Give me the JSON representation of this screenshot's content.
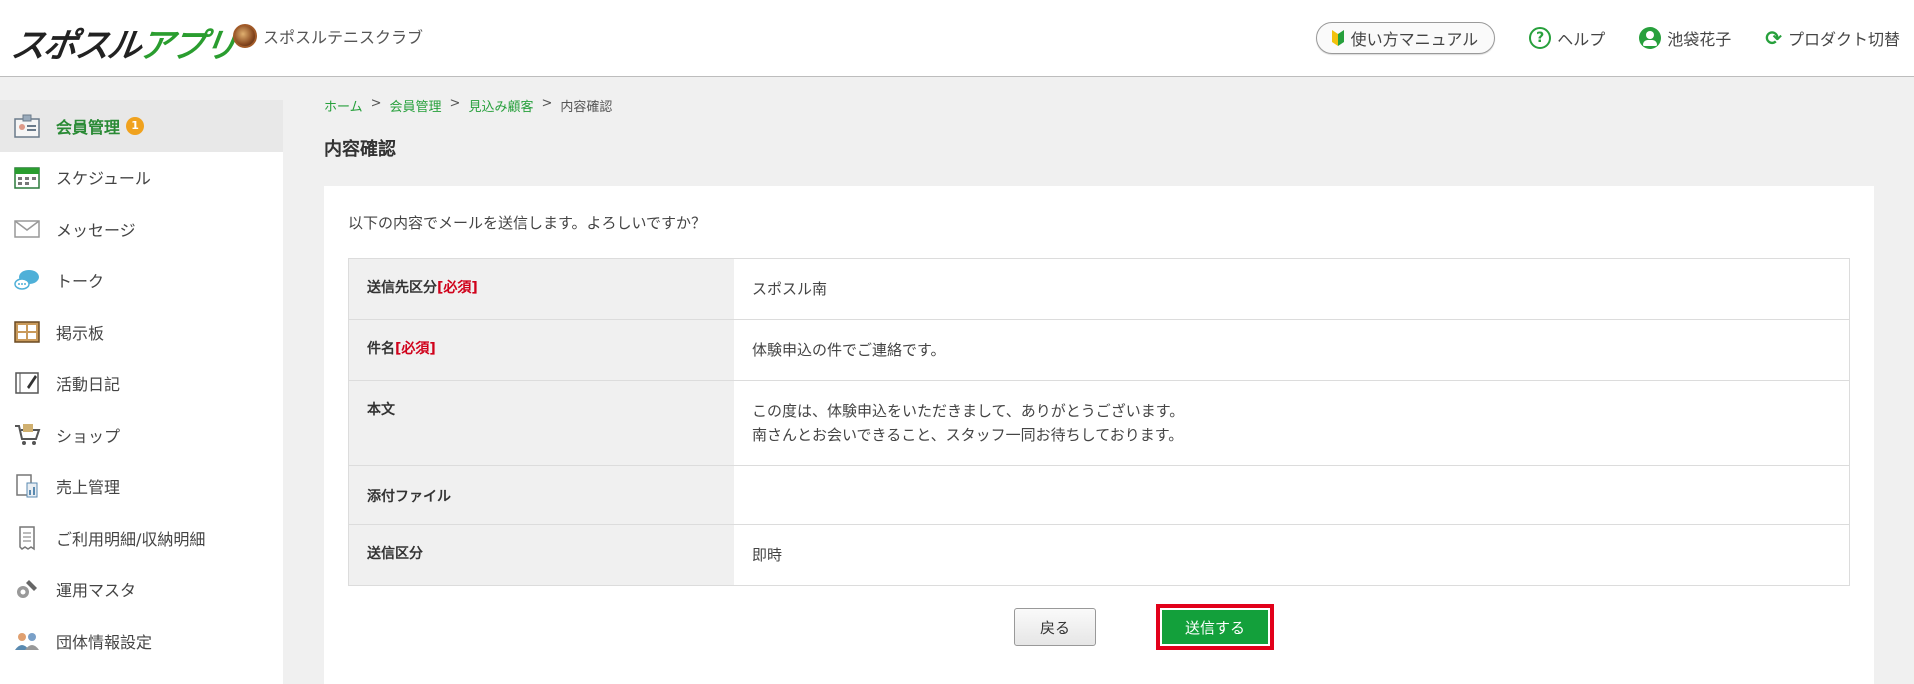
{
  "header": {
    "logo_part1": "スポスル",
    "logo_part2": "アプリ",
    "club_name": "スポスルテニスクラブ",
    "manual_label": "使い方マニュアル",
    "help_label": "ヘルプ",
    "user_name": "池袋花子",
    "switch_label": "プロダクト切替"
  },
  "sidebar": {
    "items": [
      {
        "label": "会員管理",
        "badge": "1",
        "icon": "member-icon"
      },
      {
        "label": "スケジュール",
        "icon": "calendar-icon"
      },
      {
        "label": "メッセージ",
        "icon": "envelope-icon"
      },
      {
        "label": "トーク",
        "icon": "chat-icon"
      },
      {
        "label": "掲示板",
        "icon": "board-icon"
      },
      {
        "label": "活動日記",
        "icon": "diary-icon"
      },
      {
        "label": "ショップ",
        "icon": "cart-icon"
      },
      {
        "label": "売上管理",
        "icon": "sales-icon"
      },
      {
        "label": "ご利用明細/収納明細",
        "icon": "receipt-icon"
      },
      {
        "label": "運用マスタ",
        "icon": "settings-icon"
      },
      {
        "label": "団体情報設定",
        "icon": "group-icon"
      }
    ]
  },
  "breadcrumb": {
    "home": "ホーム",
    "sep": ">",
    "members": "会員管理",
    "prospects": "見込み顧客",
    "current": "内容確認"
  },
  "page": {
    "title": "内容確認",
    "intro": "以下の内容でメールを送信します。よろしいですか？"
  },
  "form": {
    "required_mark": "[必須]",
    "rows": [
      {
        "label": "送信先区分",
        "value": "スポスル南"
      },
      {
        "label": "件名",
        "value": "体験申込の件でご連絡です。"
      },
      {
        "label": "本文",
        "value_line1": "この度は、体験申込をいただきまして、ありがとうございます。",
        "value_line2": "南さんとお会いできること、スタッフ一同お待ちしております。"
      },
      {
        "label": "添付ファイル",
        "value": ""
      },
      {
        "label": "送信区分",
        "value": "即時"
      }
    ]
  },
  "actions": {
    "back_label": "戻る",
    "send_label": "送信する"
  },
  "colors": {
    "accent_green": "#27a03c",
    "send_button": "#13a03b",
    "highlight_red": "#e2001a",
    "badge_orange": "#f0a21e"
  }
}
